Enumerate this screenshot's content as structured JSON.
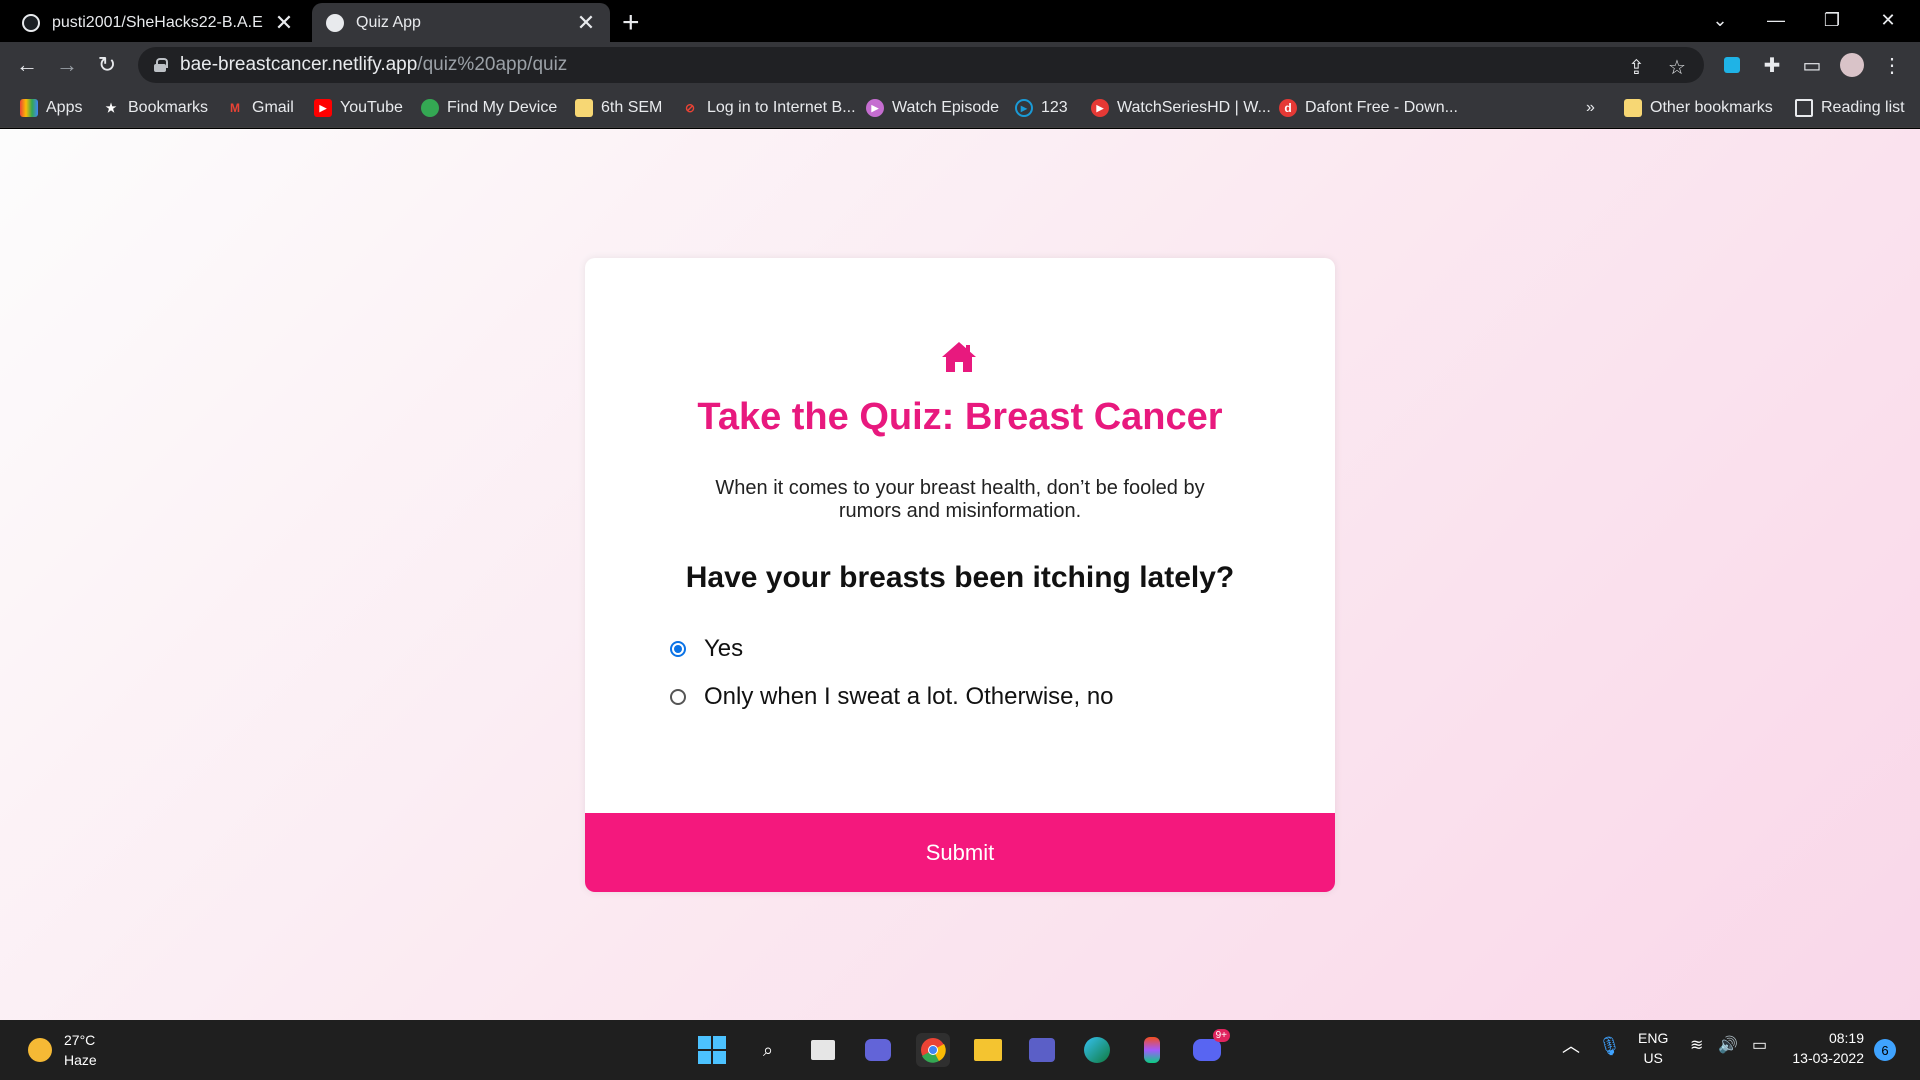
{
  "browser": {
    "tabs": [
      {
        "title": "pusti2001/SheHacks22-B.A.E",
        "active": false
      },
      {
        "title": "Quiz App",
        "active": true
      }
    ],
    "url_host": "bae-breastcancer.netlify.app",
    "url_path": "/quiz%20app/quiz",
    "bookmarks": [
      {
        "label": "Apps",
        "icon": "apps-grid-icon"
      },
      {
        "label": "Bookmarks",
        "icon": "star-icon"
      },
      {
        "label": "Gmail",
        "icon": "gmail-icon"
      },
      {
        "label": "YouTube",
        "icon": "youtube-icon"
      },
      {
        "label": "Find My Device",
        "icon": "find-device-icon"
      },
      {
        "label": "6th SEM",
        "icon": "folder-icon"
      },
      {
        "label": "Log in to Internet B...",
        "icon": "link-icon"
      },
      {
        "label": "Watch Episode",
        "icon": "play-icon"
      },
      {
        "label": "123",
        "icon": "play-circle-icon"
      },
      {
        "label": "WatchSeriesHD | W...",
        "icon": "play-icon"
      },
      {
        "label": "Dafont Free - Down...",
        "icon": "dafont-icon"
      }
    ],
    "overflow_label": "»",
    "other_bookmarks": "Other bookmarks",
    "reading_list": "Reading list"
  },
  "quiz": {
    "title": "Take the Quiz: Breast Cancer",
    "intro": "When it comes to your breast health, don’t be fooled by rumors and misinformation.",
    "question": "Have your breasts been itching lately?",
    "options": [
      {
        "label": "Yes",
        "selected": true
      },
      {
        "label": "Only when I sweat a lot. Otherwise, no",
        "selected": false
      }
    ],
    "submit_label": "Submit",
    "accent_color": "#e8197e",
    "button_color": "#f4187d"
  },
  "taskbar": {
    "temperature": "27°C",
    "condition": "Haze",
    "language": "ENG",
    "region": "US",
    "time": "08:19",
    "date": "13-03-2022",
    "notification_count": "6",
    "discord_badge": "9+"
  }
}
